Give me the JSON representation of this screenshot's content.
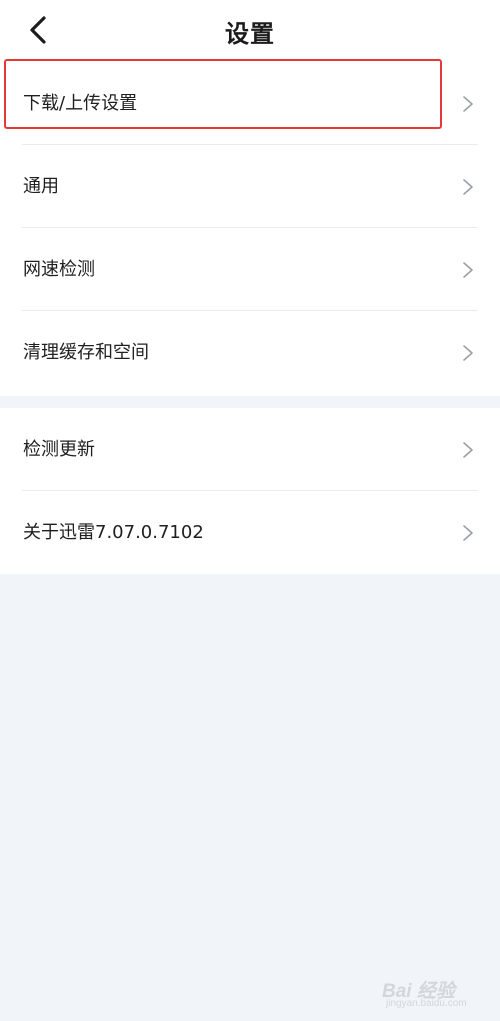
{
  "header": {
    "title": "设置",
    "back_icon": "chevron-left-icon"
  },
  "settings_groups": [
    {
      "items": [
        {
          "label": "下载/上传设置",
          "icon": "chevron-right-icon",
          "highlighted": true
        },
        {
          "label": "通用",
          "icon": "chevron-right-icon"
        },
        {
          "label": "网速检测",
          "icon": "chevron-right-icon"
        },
        {
          "label": "清理缓存和空间",
          "icon": "chevron-right-icon"
        }
      ]
    },
    {
      "items": [
        {
          "label": "检测更新",
          "icon": "chevron-right-icon"
        },
        {
          "label": "关于迅雷7.07.0.7102",
          "icon": "chevron-right-icon"
        }
      ]
    }
  ],
  "annotation": {
    "highlight_color": "#e53935"
  },
  "watermark": {
    "text": "Bai 经验",
    "subtext": "jingyan.baidu.com"
  },
  "colors": {
    "background": "#f1f4f8",
    "surface": "#ffffff",
    "divider": "#e9ecef",
    "chevron": "#9aa0a6"
  }
}
